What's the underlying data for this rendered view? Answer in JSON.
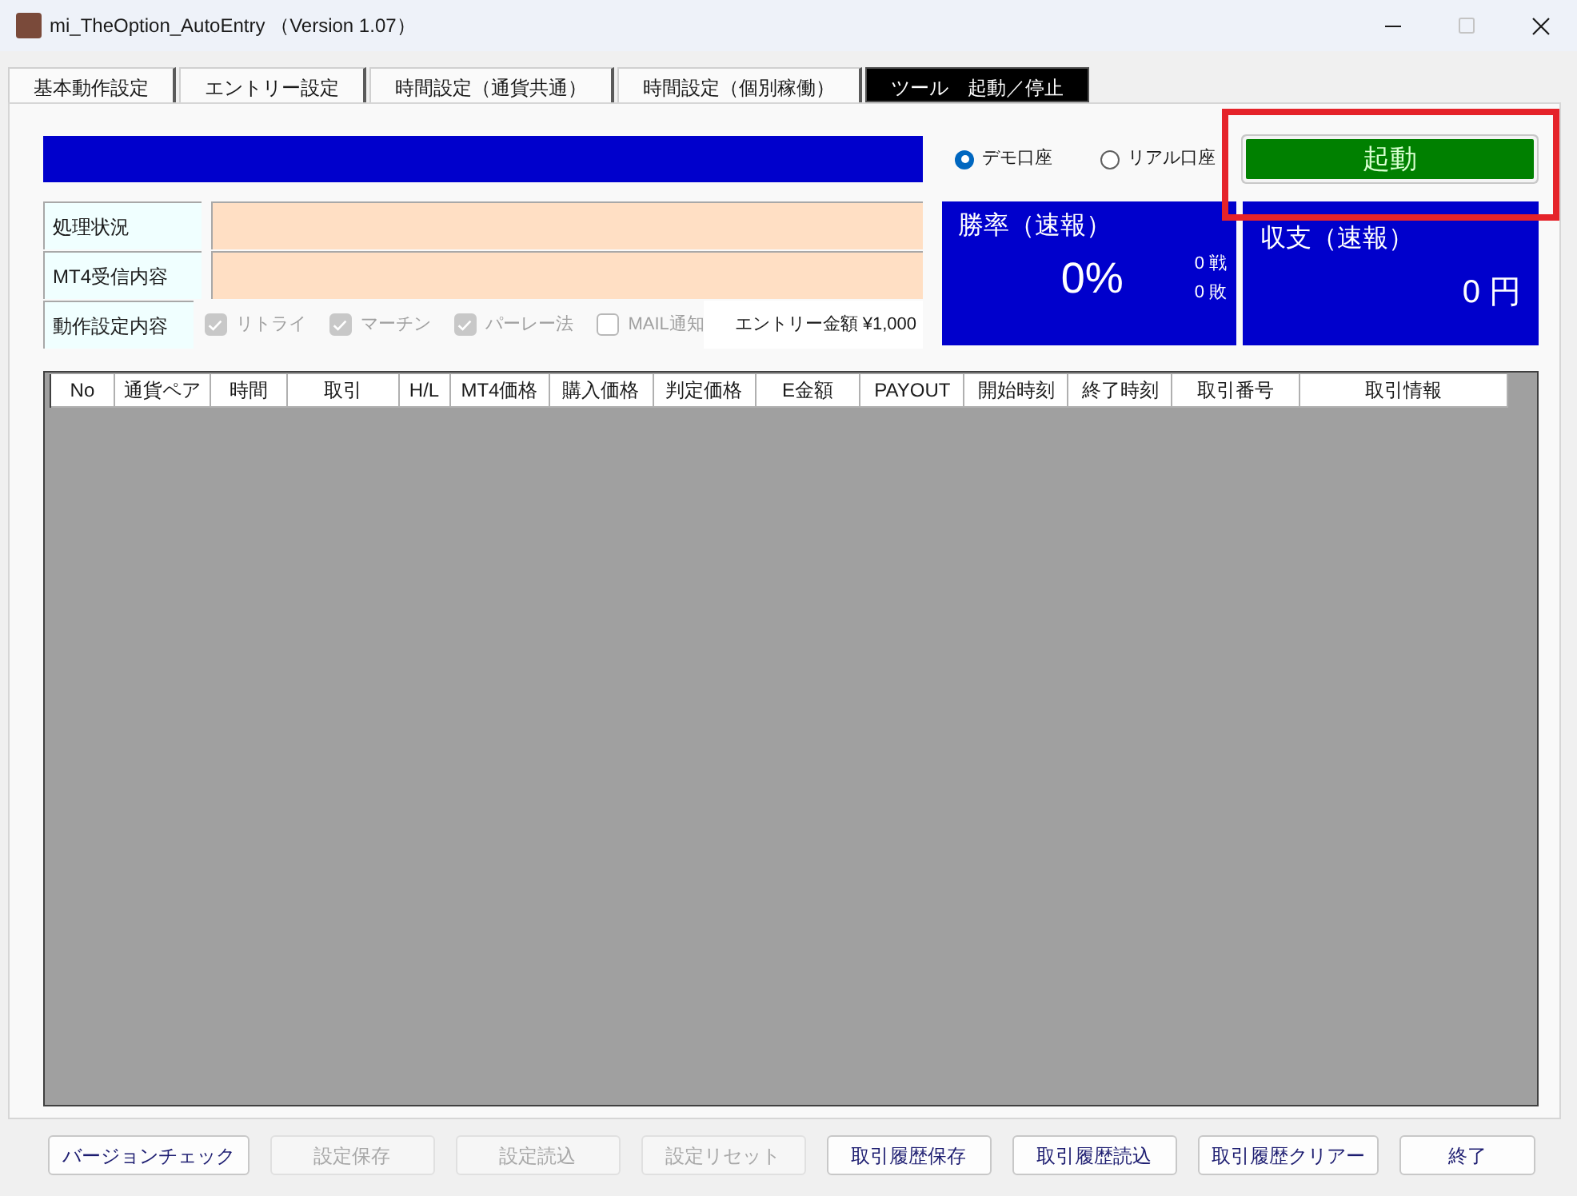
{
  "window": {
    "title": "mi_TheOption_AutoEntry （Version 1.07）",
    "maximize_enabled": false
  },
  "tabs": [
    {
      "label": "基本動作設定",
      "selected": false
    },
    {
      "label": "エントリー設定",
      "selected": false
    },
    {
      "label": "時間設定（通貨共通）",
      "selected": false
    },
    {
      "label": "時間設定（個別稼働）",
      "selected": false
    },
    {
      "label": "ツール　起動／停止",
      "selected": true
    }
  ],
  "account_types": [
    {
      "label": "デモ口座",
      "selected": true
    },
    {
      "label": "リアル口座",
      "selected": false
    }
  ],
  "start_button": {
    "label": "起動",
    "highlighted": true
  },
  "status_fields": [
    {
      "label": "処理状況"
    },
    {
      "label": "MT4受信内容"
    }
  ],
  "settings_row": {
    "label": "動作設定内容",
    "options": [
      {
        "label": "リトライ",
        "checked": true,
        "disabled": true
      },
      {
        "label": "マーチン",
        "checked": true,
        "disabled": true
      },
      {
        "label": "パーレー法",
        "checked": true,
        "disabled": true
      },
      {
        "label": "MAIL通知",
        "checked": false,
        "disabled": true
      }
    ],
    "entry_amount": "エントリー金額 ¥1,000"
  },
  "win_rate": {
    "title": "勝率（速報）",
    "value": "0%",
    "wins": "0 戦",
    "losses": "0 敗"
  },
  "balance": {
    "title": "収支（速報）",
    "value": "0 円"
  },
  "trade_table": {
    "columns": [
      "No",
      "通貨ペア",
      "時間",
      "取引",
      "H/L",
      "MT4価格",
      "購入価格",
      "判定価格",
      "E金額",
      "PAYOUT",
      "開始時刻",
      "終了時刻",
      "取引番号",
      "取引情報"
    ]
  },
  "buttons": [
    {
      "label": "バージョンチェック",
      "disabled": false
    },
    {
      "label": "設定保存",
      "disabled": true
    },
    {
      "label": "設定読込",
      "disabled": true
    },
    {
      "label": "設定リセット",
      "disabled": true
    },
    {
      "label": "取引履歴保存",
      "disabled": false
    },
    {
      "label": "取引履歴読込",
      "disabled": false
    },
    {
      "label": "取引履歴クリアー",
      "disabled": false
    },
    {
      "label": "終了",
      "disabled": false
    }
  ]
}
